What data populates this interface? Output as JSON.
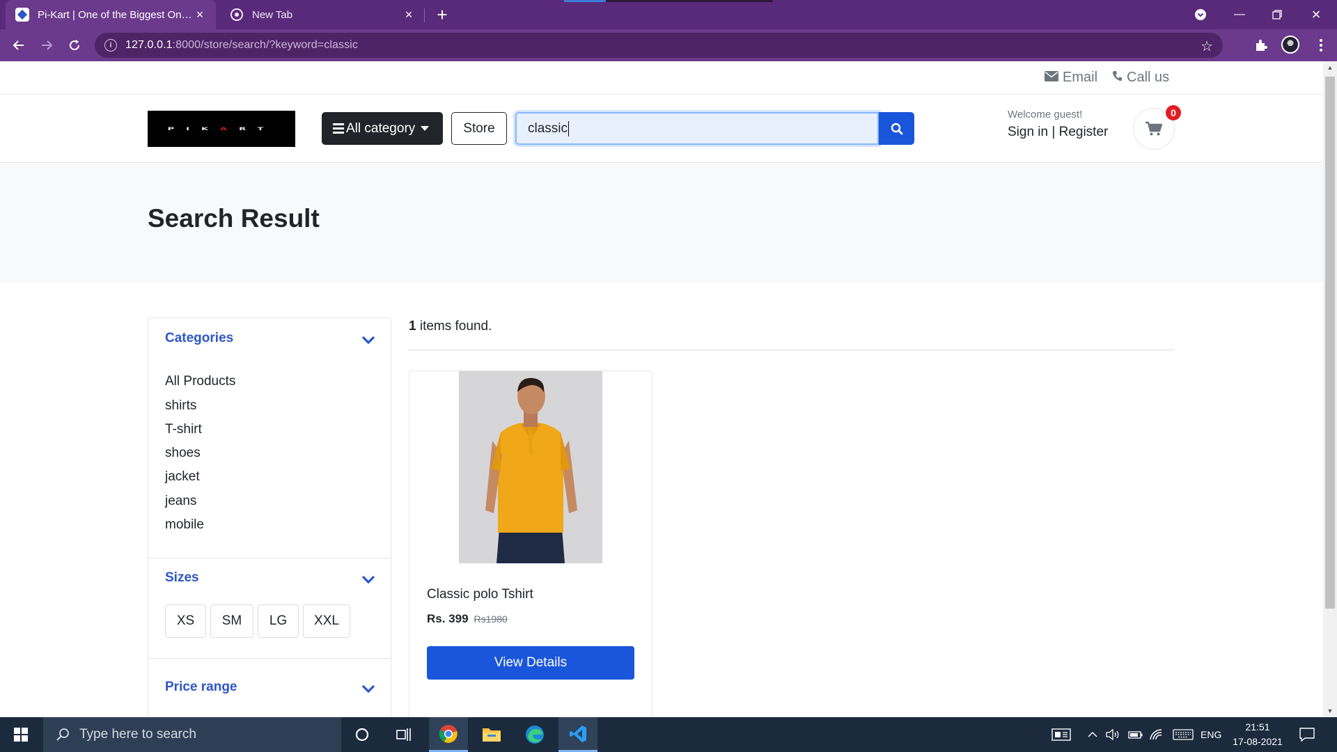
{
  "browser": {
    "tabs": [
      {
        "title": "Pi-Kart | One of the Biggest Online Shopping Platform",
        "active": true
      },
      {
        "title": "New Tab",
        "active": false
      }
    ],
    "url_host": "127.0.0.1",
    "url_rest": ":8000/store/search/?keyword=classic",
    "theme_color": "#6b3a8c"
  },
  "topbar": {
    "email_label": "Email",
    "call_label": "Call us"
  },
  "header": {
    "logo_text": "PIKART",
    "category_button": "All category",
    "store_button": "Store",
    "search_value": "classic",
    "welcome": "Welcome guest!",
    "sign_in": "Sign in",
    "auth_separator": " | ",
    "register": "Register",
    "cart_count": "0"
  },
  "page": {
    "title": "Search Result"
  },
  "sidebar": {
    "categories_heading": "Categories",
    "categories": [
      "All Products",
      "shirts",
      "T-shirt",
      "shoes",
      "jacket",
      "jeans",
      "mobile"
    ],
    "sizes_heading": "Sizes",
    "sizes": [
      "XS",
      "SM",
      "LG",
      "XXL"
    ],
    "price_heading": "Price range"
  },
  "results": {
    "count": "1",
    "count_suffix": " items found.",
    "products": [
      {
        "name": "Classic polo Tshirt",
        "price": "Rs. 399",
        "old_price": "Rs1980",
        "button": "View Details"
      }
    ]
  },
  "taskbar": {
    "search_placeholder": "Type here to search",
    "language": "ENG",
    "time": "21:51",
    "date": "17-08-2021"
  },
  "colors": {
    "accent": "#1a56db",
    "heading_blue": "#2c56c7",
    "badge_red": "#e31c25"
  }
}
